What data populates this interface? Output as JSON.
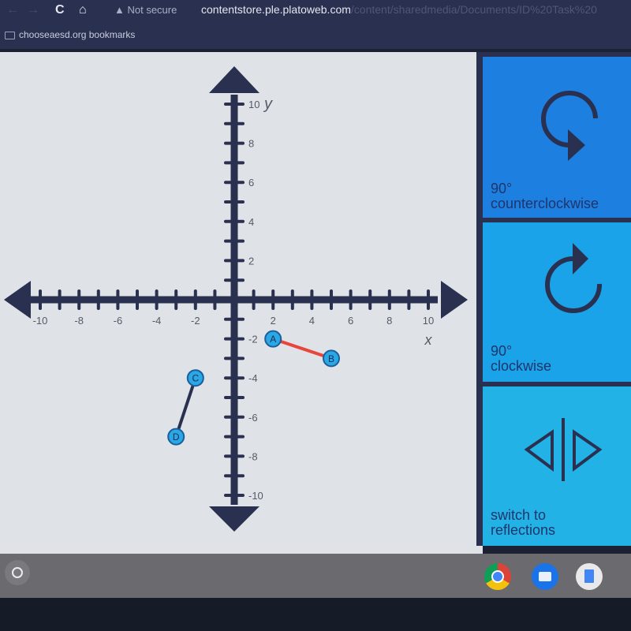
{
  "browser": {
    "back_icon": "←",
    "forward_icon": "→",
    "reload_icon": "C",
    "home_icon": "⌂",
    "security_label": "▲ Not secure",
    "url_host": "contentstore.ple.platoweb.com",
    "url_path": "/content/sharedmedia/Documents/ID%20Task%20",
    "bookmark_label": "chooseaesd.org bookmarks"
  },
  "graph": {
    "x_axis_label": "x",
    "y_axis_label": "y",
    "x_range": [
      -10,
      10
    ],
    "y_range": [
      -10,
      10
    ],
    "x_tick_labels": [
      "-10",
      "-8",
      "-6",
      "-4",
      "-2",
      "2",
      "4",
      "6",
      "8",
      "10"
    ],
    "y_tick_labels": [
      "10",
      "8",
      "6",
      "4",
      "2",
      "-2",
      "-4",
      "-6",
      "-8",
      "-10"
    ],
    "points": [
      {
        "name": "A",
        "x": 2,
        "y": -2
      },
      {
        "name": "B",
        "x": 5,
        "y": -3
      },
      {
        "name": "C",
        "x": -2,
        "y": -4
      },
      {
        "name": "D",
        "x": -3,
        "y": -7
      }
    ],
    "segments": [
      {
        "from": "A",
        "to": "B",
        "color": "#e8453c"
      },
      {
        "from": "C",
        "to": "D",
        "color": "#2a3150"
      }
    ],
    "colors": {
      "axis": "#2a3150",
      "point_fill": "#2aa8e6",
      "point_stroke": "#1a5e9a"
    }
  },
  "tools": [
    {
      "line1": "90°",
      "line2": "counterclockwise",
      "icon": "rotate-counterclockwise-icon"
    },
    {
      "line1": "90°",
      "line2": "clockwise",
      "icon": "rotate-clockwise-icon"
    },
    {
      "line1": "switch to",
      "line2": "reflections",
      "icon": "reflection-icon"
    }
  ],
  "shelf": {
    "apps": [
      "chrome",
      "files",
      "docs"
    ]
  }
}
